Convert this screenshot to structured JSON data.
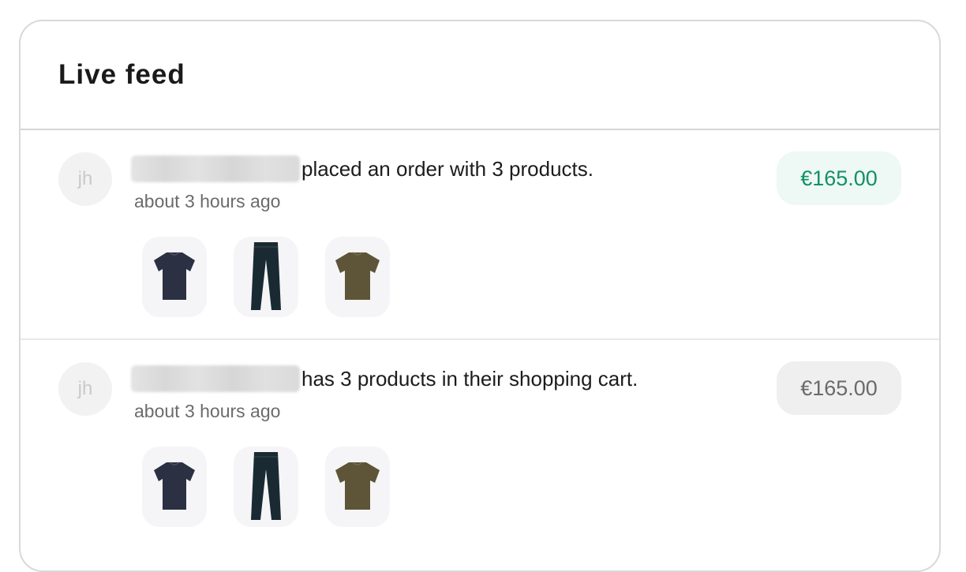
{
  "feed": {
    "title": "Live feed",
    "items": [
      {
        "avatar_initials": "jh",
        "action_text": "placed an order with 3 products.",
        "time": "about 3 hours ago",
        "price": "€165.00",
        "price_status": "order",
        "products": [
          {
            "icon": "navy-tshirt-icon",
            "color": "#2b3142"
          },
          {
            "icon": "dark-trousers-icon",
            "color": "#1a2a33"
          },
          {
            "icon": "olive-tshirt-icon",
            "color": "#5e5437"
          }
        ]
      },
      {
        "avatar_initials": "jh",
        "action_text": "has 3 products in their shopping cart.",
        "time": "about 3 hours ago",
        "price": "€165.00",
        "price_status": "cart",
        "products": [
          {
            "icon": "navy-tshirt-icon",
            "color": "#2b3142"
          },
          {
            "icon": "dark-trousers-icon",
            "color": "#1a2a33"
          },
          {
            "icon": "olive-tshirt-icon",
            "color": "#5e5437"
          }
        ]
      }
    ]
  },
  "colors": {
    "order_price_text": "#139066",
    "order_price_bg": "#eef8f4",
    "cart_price_text": "#6a6a6a",
    "cart_price_bg": "#efefef"
  }
}
